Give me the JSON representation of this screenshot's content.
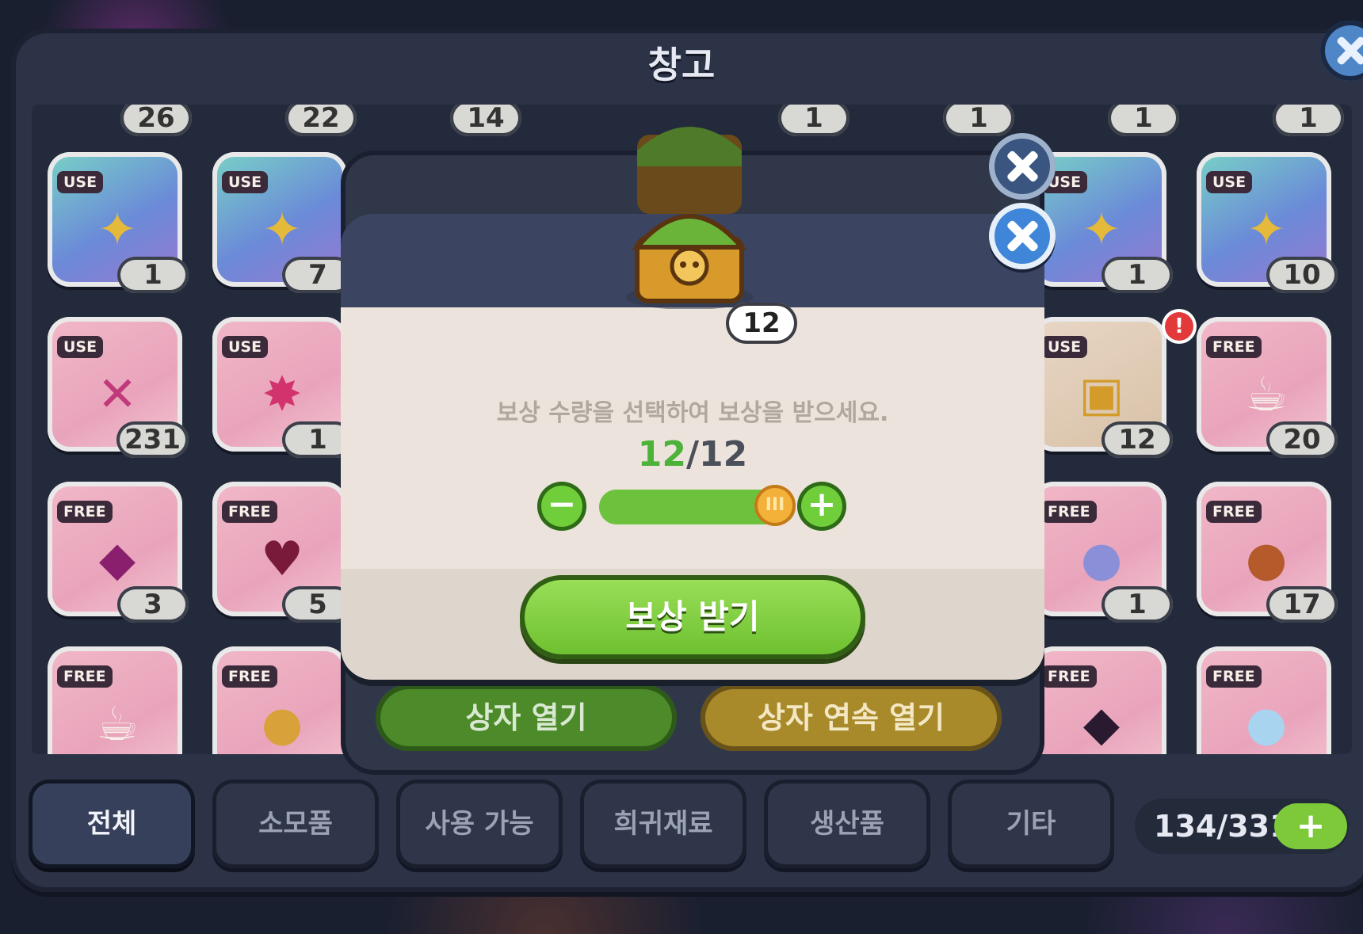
{
  "window": {
    "title": "창고"
  },
  "top_row_counts": [
    "26",
    "22",
    "14",
    "1",
    "1",
    "1",
    "1"
  ],
  "grid": {
    "row1": [
      {
        "badge": "USE",
        "qty": "1",
        "icon": "gold-crest-icon"
      },
      {
        "badge": "USE",
        "qty": "7",
        "icon": "gold-crest-icon"
      },
      {
        "badge": "USE",
        "qty": "1",
        "icon": "gold-crest-icon"
      },
      {
        "badge": "USE",
        "qty": "10",
        "icon": "gold-crest-icon"
      }
    ],
    "row2": [
      {
        "badge": "USE",
        "qty": "231",
        "icon": "crossed-tools-icon"
      },
      {
        "badge": "USE",
        "qty": "1",
        "icon": "star-emblem-icon"
      },
      {
        "badge": "USE",
        "qty": "12",
        "icon": "treasure-chest-icon"
      },
      {
        "badge": "FREE",
        "qty": "20",
        "icon": "coffee-cup-icon"
      }
    ],
    "row3": [
      {
        "badge": "FREE",
        "qty": "3",
        "icon": "purple-gem-icon"
      },
      {
        "badge": "FREE",
        "qty": "5",
        "icon": "potion-bottle-icon"
      },
      {
        "badge": "FREE",
        "qty": "1",
        "icon": "ghost-blob-icon"
      },
      {
        "badge": "FREE",
        "qty": "17",
        "icon": "roast-meat-icon"
      }
    ],
    "row4": [
      {
        "badge": "FREE",
        "icon": "latte-icon"
      },
      {
        "badge": "FREE",
        "icon": "bread-icon"
      },
      {
        "badge": "FREE",
        "icon": "dark-crystal-icon"
      },
      {
        "badge": "FREE",
        "icon": "slime-icon"
      }
    ],
    "alert": "!"
  },
  "tabs": [
    "전체",
    "소모품",
    "사용 가능",
    "희귀재료",
    "생산품",
    "기타"
  ],
  "capacity": {
    "text": "134/331",
    "plus": "+"
  },
  "back_dialog": {
    "open_button": "상자 열기",
    "open_repeat_button": "상자 연속 열기"
  },
  "dialog": {
    "chest_count": "12",
    "instruction": "보상 수량을 선택하여 보상을 받으세요.",
    "amount_current": "12",
    "amount_sep_total": "/12",
    "minus": "−",
    "plus": "+",
    "slider_value": 1.0,
    "knob_label": "III",
    "claim_button": "보상 받기"
  },
  "colors": {
    "accent_green": "#6cc23c",
    "dialog_header": "#3b4460",
    "close_blue": "#3f86d8"
  }
}
